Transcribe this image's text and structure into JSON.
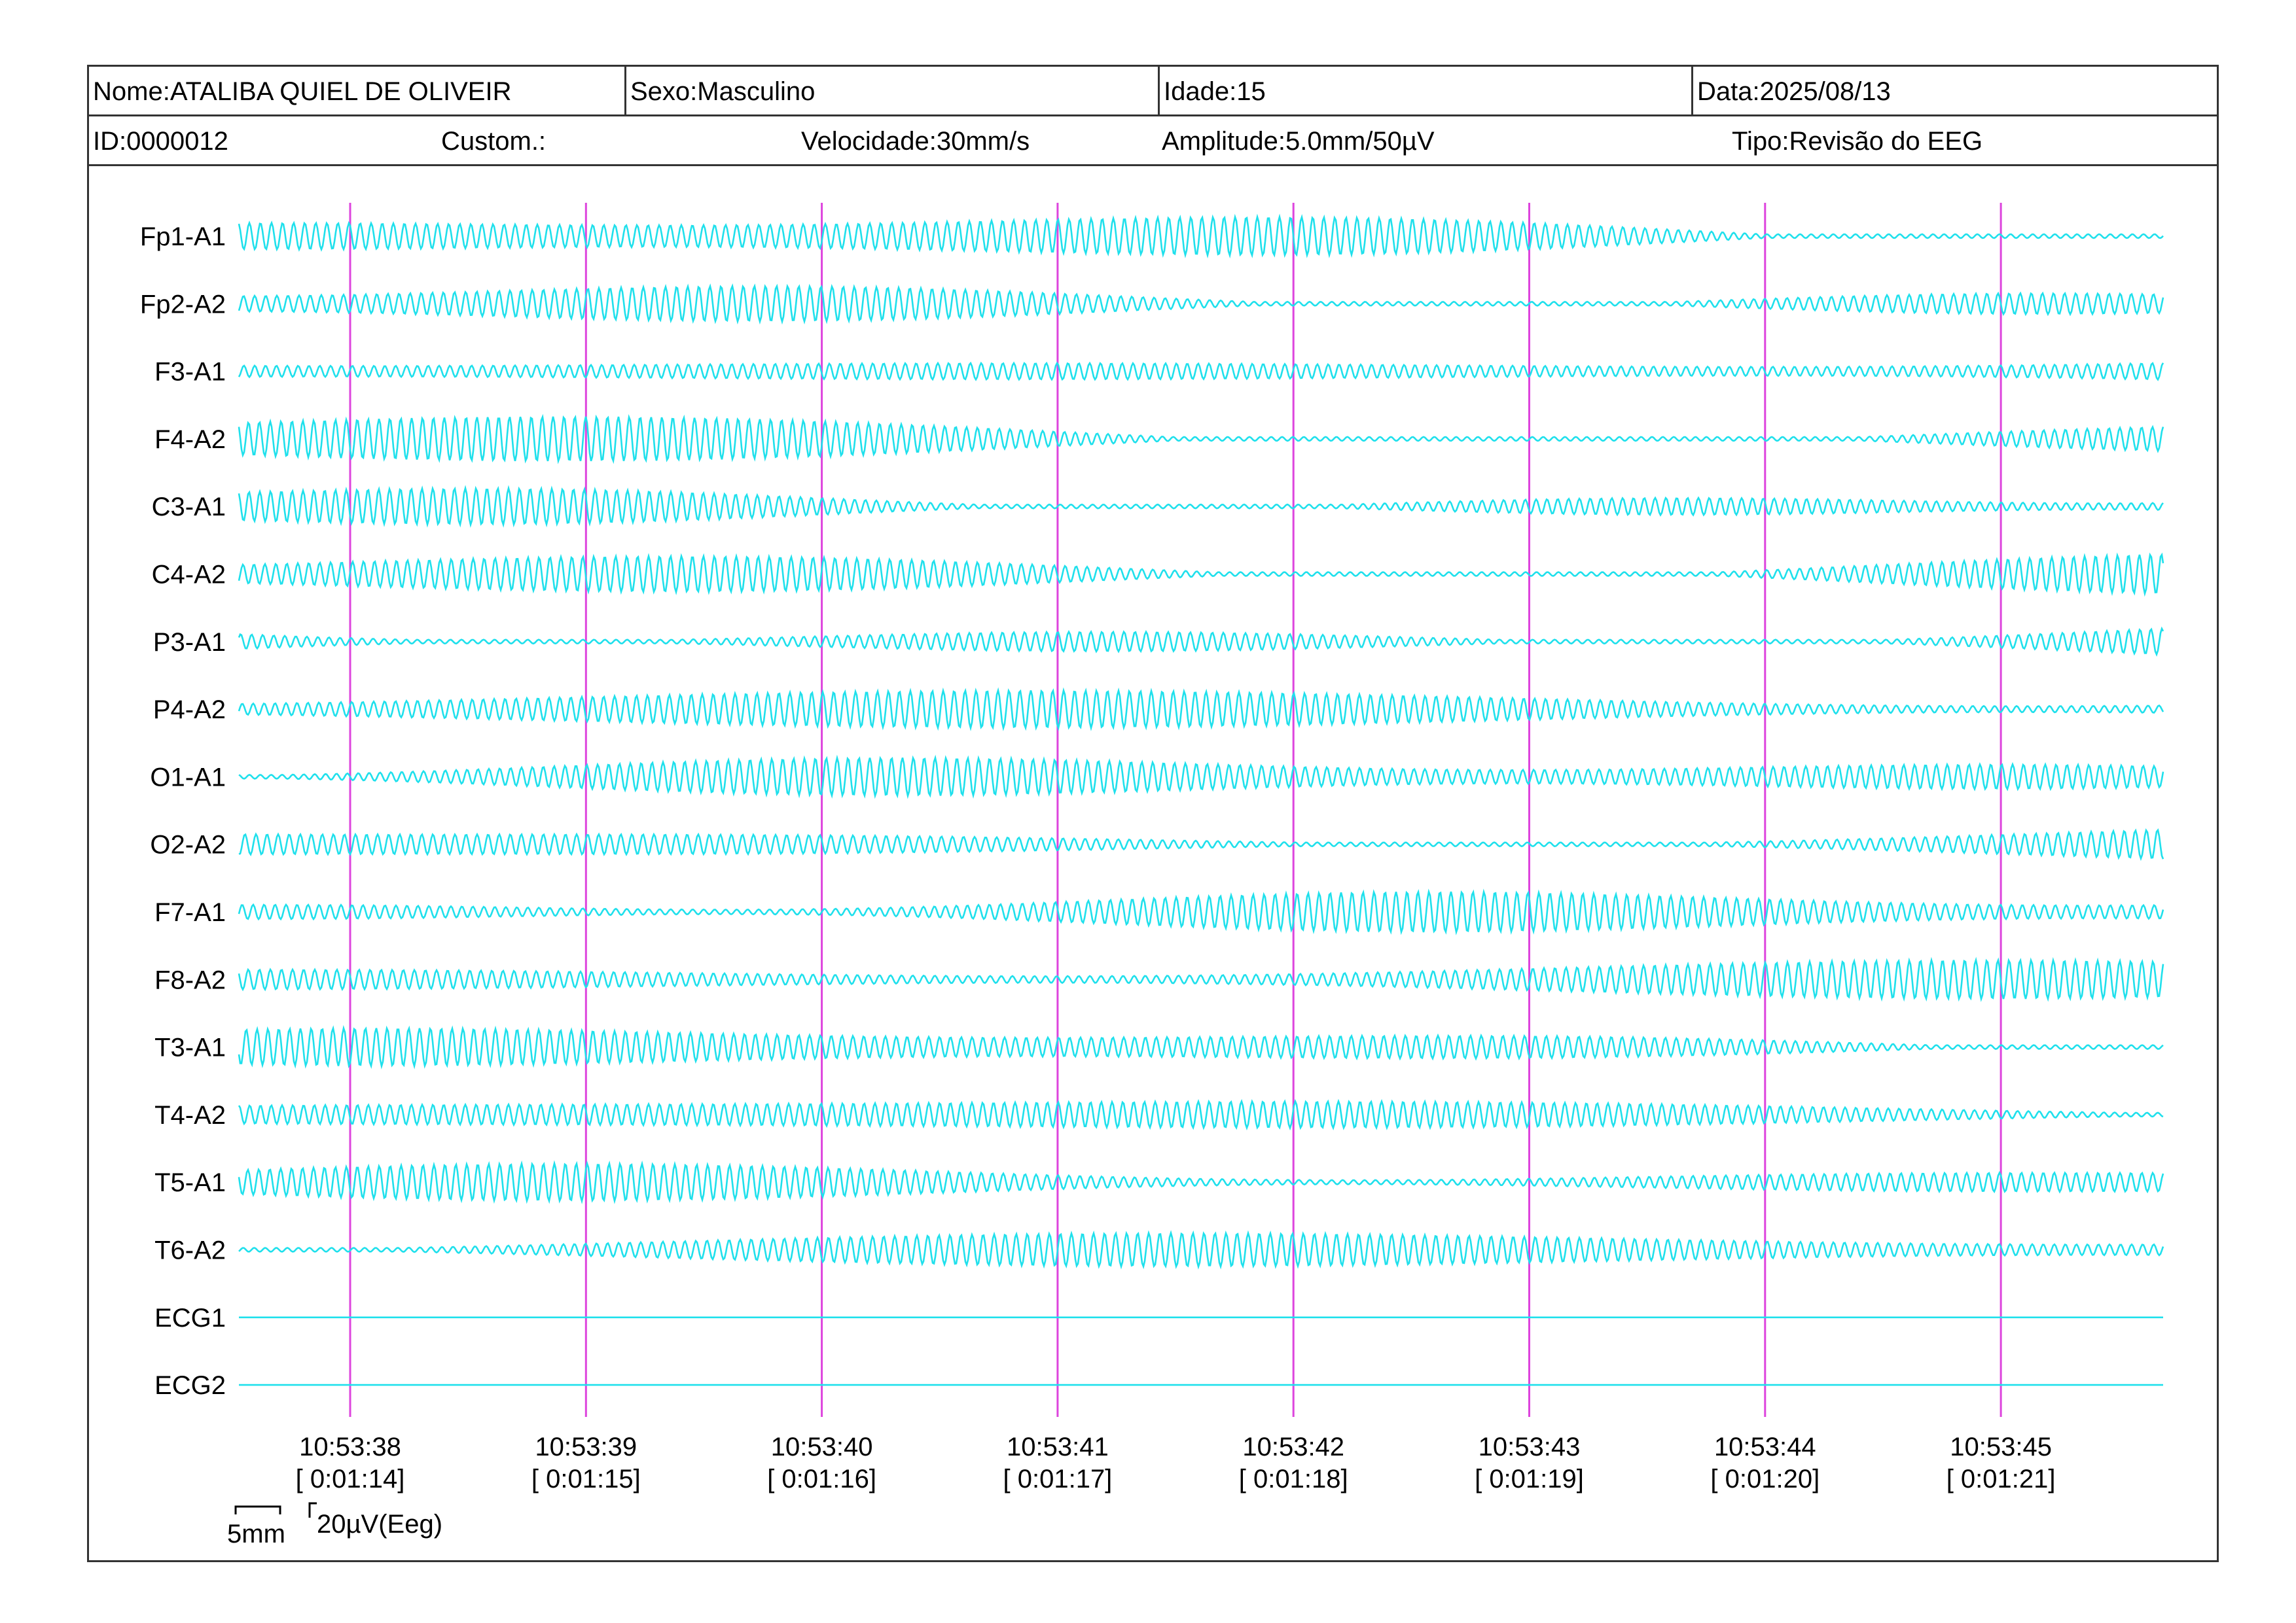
{
  "header": {
    "name": "Nome:ATALIBA QUIEL DE OLIVEIR",
    "sex": "Sexo:Masculino",
    "age": "Idade:15",
    "date": "Data:2025/08/13",
    "id": "ID:0000012",
    "custom": "Custom.:",
    "speed": "Velocidade:30mm/s",
    "amplitude": "Amplitude:5.0mm/50µV",
    "type": "Tipo:Revisão do EEG"
  },
  "colors": {
    "trace": "#1fe0ec",
    "marker": "#dd44dd",
    "border": "#333333"
  },
  "chart_data": {
    "type": "line",
    "channels": [
      "Fp1-A1",
      "Fp2-A2",
      "F3-A1",
      "F4-A2",
      "C3-A1",
      "C4-A2",
      "P3-A1",
      "P4-A2",
      "O1-A1",
      "O2-A2",
      "F7-A1",
      "F8-A2",
      "T3-A1",
      "T4-A2",
      "T5-A1",
      "T6-A2",
      "ECG1",
      "ECG2"
    ],
    "time_markers": [
      {
        "time": "10:53:38",
        "elapsed": "[ 0:01:14]"
      },
      {
        "time": "10:53:39",
        "elapsed": "[ 0:01:15]"
      },
      {
        "time": "10:53:40",
        "elapsed": "[ 0:01:16]"
      },
      {
        "time": "10:53:41",
        "elapsed": "[ 0:01:17]"
      },
      {
        "time": "10:53:42",
        "elapsed": "[ 0:01:18]"
      },
      {
        "time": "10:53:43",
        "elapsed": "[ 0:01:19]"
      },
      {
        "time": "10:53:44",
        "elapsed": "[ 0:01:20]"
      },
      {
        "time": "10:53:45",
        "elapsed": "[ 0:01:21]"
      }
    ],
    "scale": {
      "time_label": "5mm",
      "amplitude_label": "20µV(Eeg)"
    }
  }
}
